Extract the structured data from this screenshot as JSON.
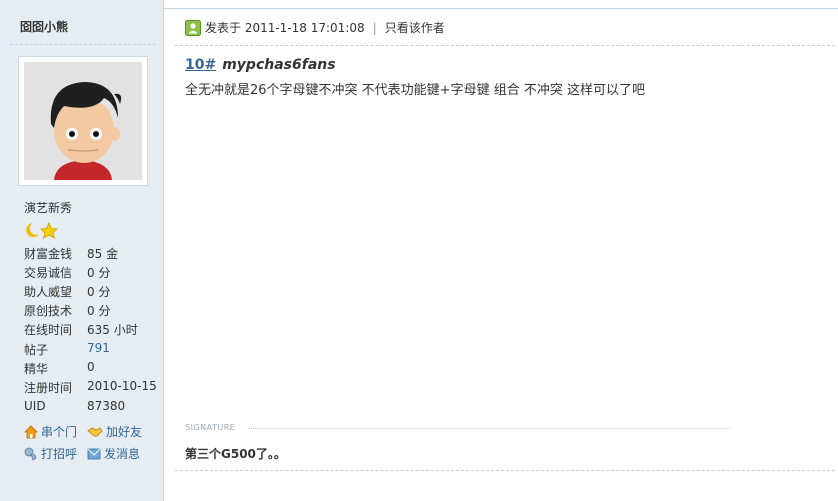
{
  "author": {
    "name": "囵囵小熊",
    "rank": "演艺新秀",
    "stats": [
      {
        "label": "财富金钱",
        "value": "85 金"
      },
      {
        "label": "交易诚信",
        "value": "0 分"
      },
      {
        "label": "助人威望",
        "value": "0 分"
      },
      {
        "label": "原创技术",
        "value": "0 分"
      },
      {
        "label": "在线时间",
        "value": "635 小时"
      },
      {
        "label": "帖子",
        "value": "791"
      },
      {
        "label": "精华",
        "value": "0"
      },
      {
        "label": "注册时间",
        "value": "2010-10-15"
      },
      {
        "label": "UID",
        "value": "87380"
      }
    ],
    "actions": {
      "serial": "串个门",
      "add_friend": "加好友",
      "greet": "打招呼",
      "message": "发消息"
    }
  },
  "post": {
    "posted_at": "发表于 2011-1-18 17:01:08",
    "only_author": "只看该作者",
    "floor": "10#",
    "title": "mypchas6fans",
    "content": "全无冲就是26个字母键不冲突 不代表功能键+字母键 组合 不冲突 这样可以了吧"
  },
  "signature": {
    "label": "SIGNATURE",
    "text": "第三个G500了。。"
  },
  "colors": {
    "sidebar_bg": "#e5edf2",
    "link": "#336699",
    "border": "#c2d5e3"
  }
}
